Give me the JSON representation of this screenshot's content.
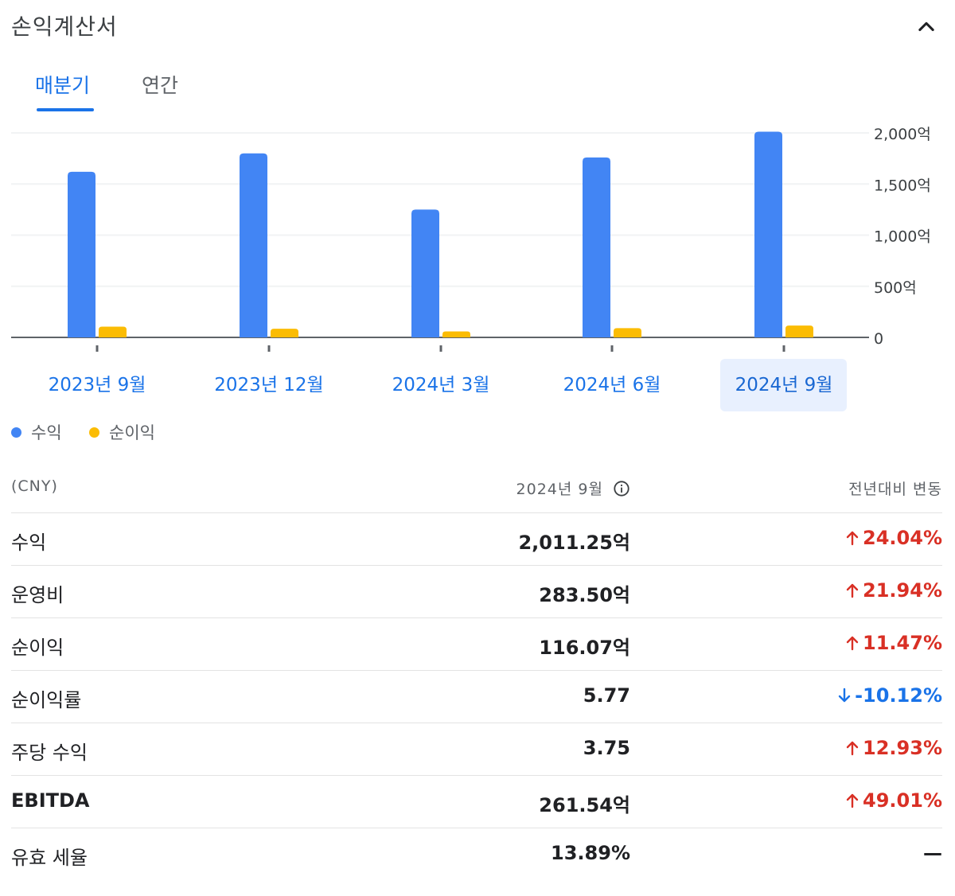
{
  "header": {
    "title": "손익계산서"
  },
  "tabs": [
    {
      "label": "매분기",
      "active": true
    },
    {
      "label": "연간",
      "active": false
    }
  ],
  "legend": [
    {
      "label": "수익",
      "color": "#4285f4"
    },
    {
      "label": "순이익",
      "color": "#fbbc04"
    }
  ],
  "chart_data": {
    "type": "bar",
    "categories": [
      "2023년 9월",
      "2023년 12월",
      "2024년 3월",
      "2024년 6월",
      "2024년 9월"
    ],
    "selected_index": 4,
    "series": [
      {
        "name": "수익",
        "color": "#4285f4",
        "values": [
          1620,
          1800,
          1250,
          1760,
          2011.25
        ]
      },
      {
        "name": "순이익",
        "color": "#fbbc04",
        "values": [
          105,
          85,
          58,
          90,
          116.07
        ]
      }
    ],
    "yticks": [
      {
        "value": 0,
        "label": "0"
      },
      {
        "value": 500,
        "label": "500억"
      },
      {
        "value": 1000,
        "label": "1,000억"
      },
      {
        "value": 1500,
        "label": "1,500억"
      },
      {
        "value": 2000,
        "label": "2,000억"
      }
    ],
    "ylim": [
      0,
      2000
    ],
    "grid": true
  },
  "table": {
    "header": {
      "currency": "(CNY)",
      "period": "2024년 9월",
      "change": "전년대비 변동"
    },
    "rows": [
      {
        "label": "수익",
        "value": "2,011.25억",
        "change": "24.04%",
        "direction": "up"
      },
      {
        "label": "운영비",
        "value": "283.50억",
        "change": "21.94%",
        "direction": "up"
      },
      {
        "label": "순이익",
        "value": "116.07억",
        "change": "11.47%",
        "direction": "up"
      },
      {
        "label": "순이익률",
        "value": "5.77",
        "change": "-10.12%",
        "direction": "down"
      },
      {
        "label": "주당 수익",
        "value": "3.75",
        "change": "12.93%",
        "direction": "up"
      },
      {
        "label": "EBITDA",
        "value": "261.54억",
        "change": "49.01%",
        "direction": "up"
      },
      {
        "label": "유효 세율",
        "value": "13.89%",
        "change": "—",
        "direction": "none"
      }
    ]
  },
  "colors": {
    "accent": "#1a73e8",
    "up": "#d93025",
    "down": "#1a73e8",
    "selected_bg": "#e8f0fe"
  }
}
